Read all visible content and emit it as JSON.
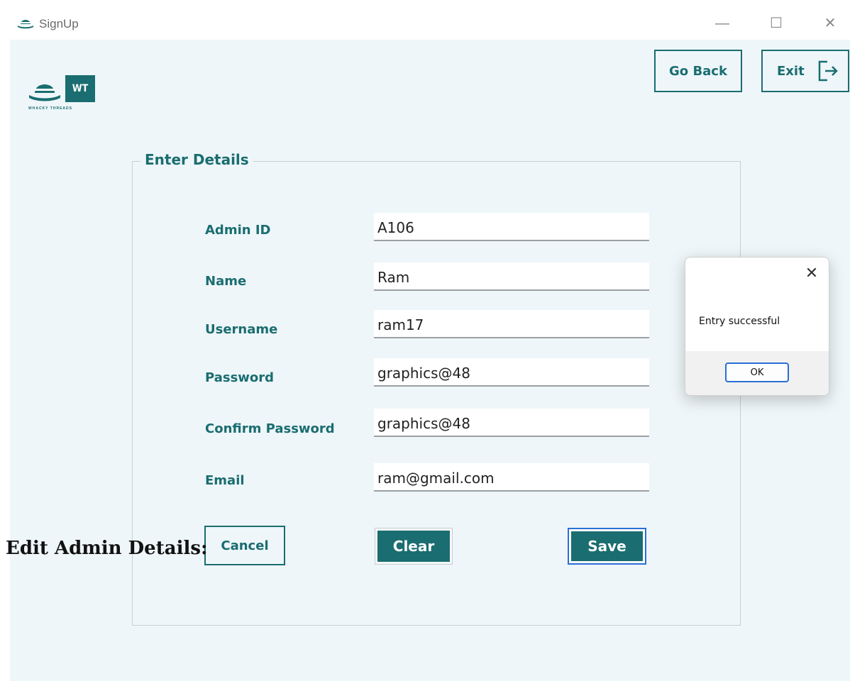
{
  "window": {
    "title": "SignUp",
    "controls": {
      "minimize": "—",
      "maximize": "☐",
      "close": "✕"
    },
    "icon": "hat-icon"
  },
  "logo": {
    "monogram": "WT",
    "caption": "WHACKY THREADS",
    "icon": "hat-icon"
  },
  "header": {
    "go_back_label": "Go Back",
    "exit_label": "Exit",
    "exit_icon": "logout-icon"
  },
  "form": {
    "group_title": "Enter Details",
    "fields": [
      {
        "label": "Admin ID",
        "value": "A106"
      },
      {
        "label": "Name",
        "value": "Ram"
      },
      {
        "label": "Username",
        "value": "ram17"
      },
      {
        "label": "Password",
        "value": "graphics@48"
      },
      {
        "label": "Confirm Password",
        "value": "graphics@48"
      },
      {
        "label": "Email",
        "value": "ram@gmail.com"
      }
    ],
    "buttons": {
      "cancel": "Cancel",
      "clear": "Clear",
      "save": "Save"
    }
  },
  "overlay_heading": "Edit Admin Details:",
  "dialog": {
    "message": "Entry successful",
    "ok_label": "OK",
    "close": "✕"
  },
  "colors": {
    "accent": "#1a6d70",
    "background": "#eef6f9",
    "focus": "#2a6fd6"
  }
}
